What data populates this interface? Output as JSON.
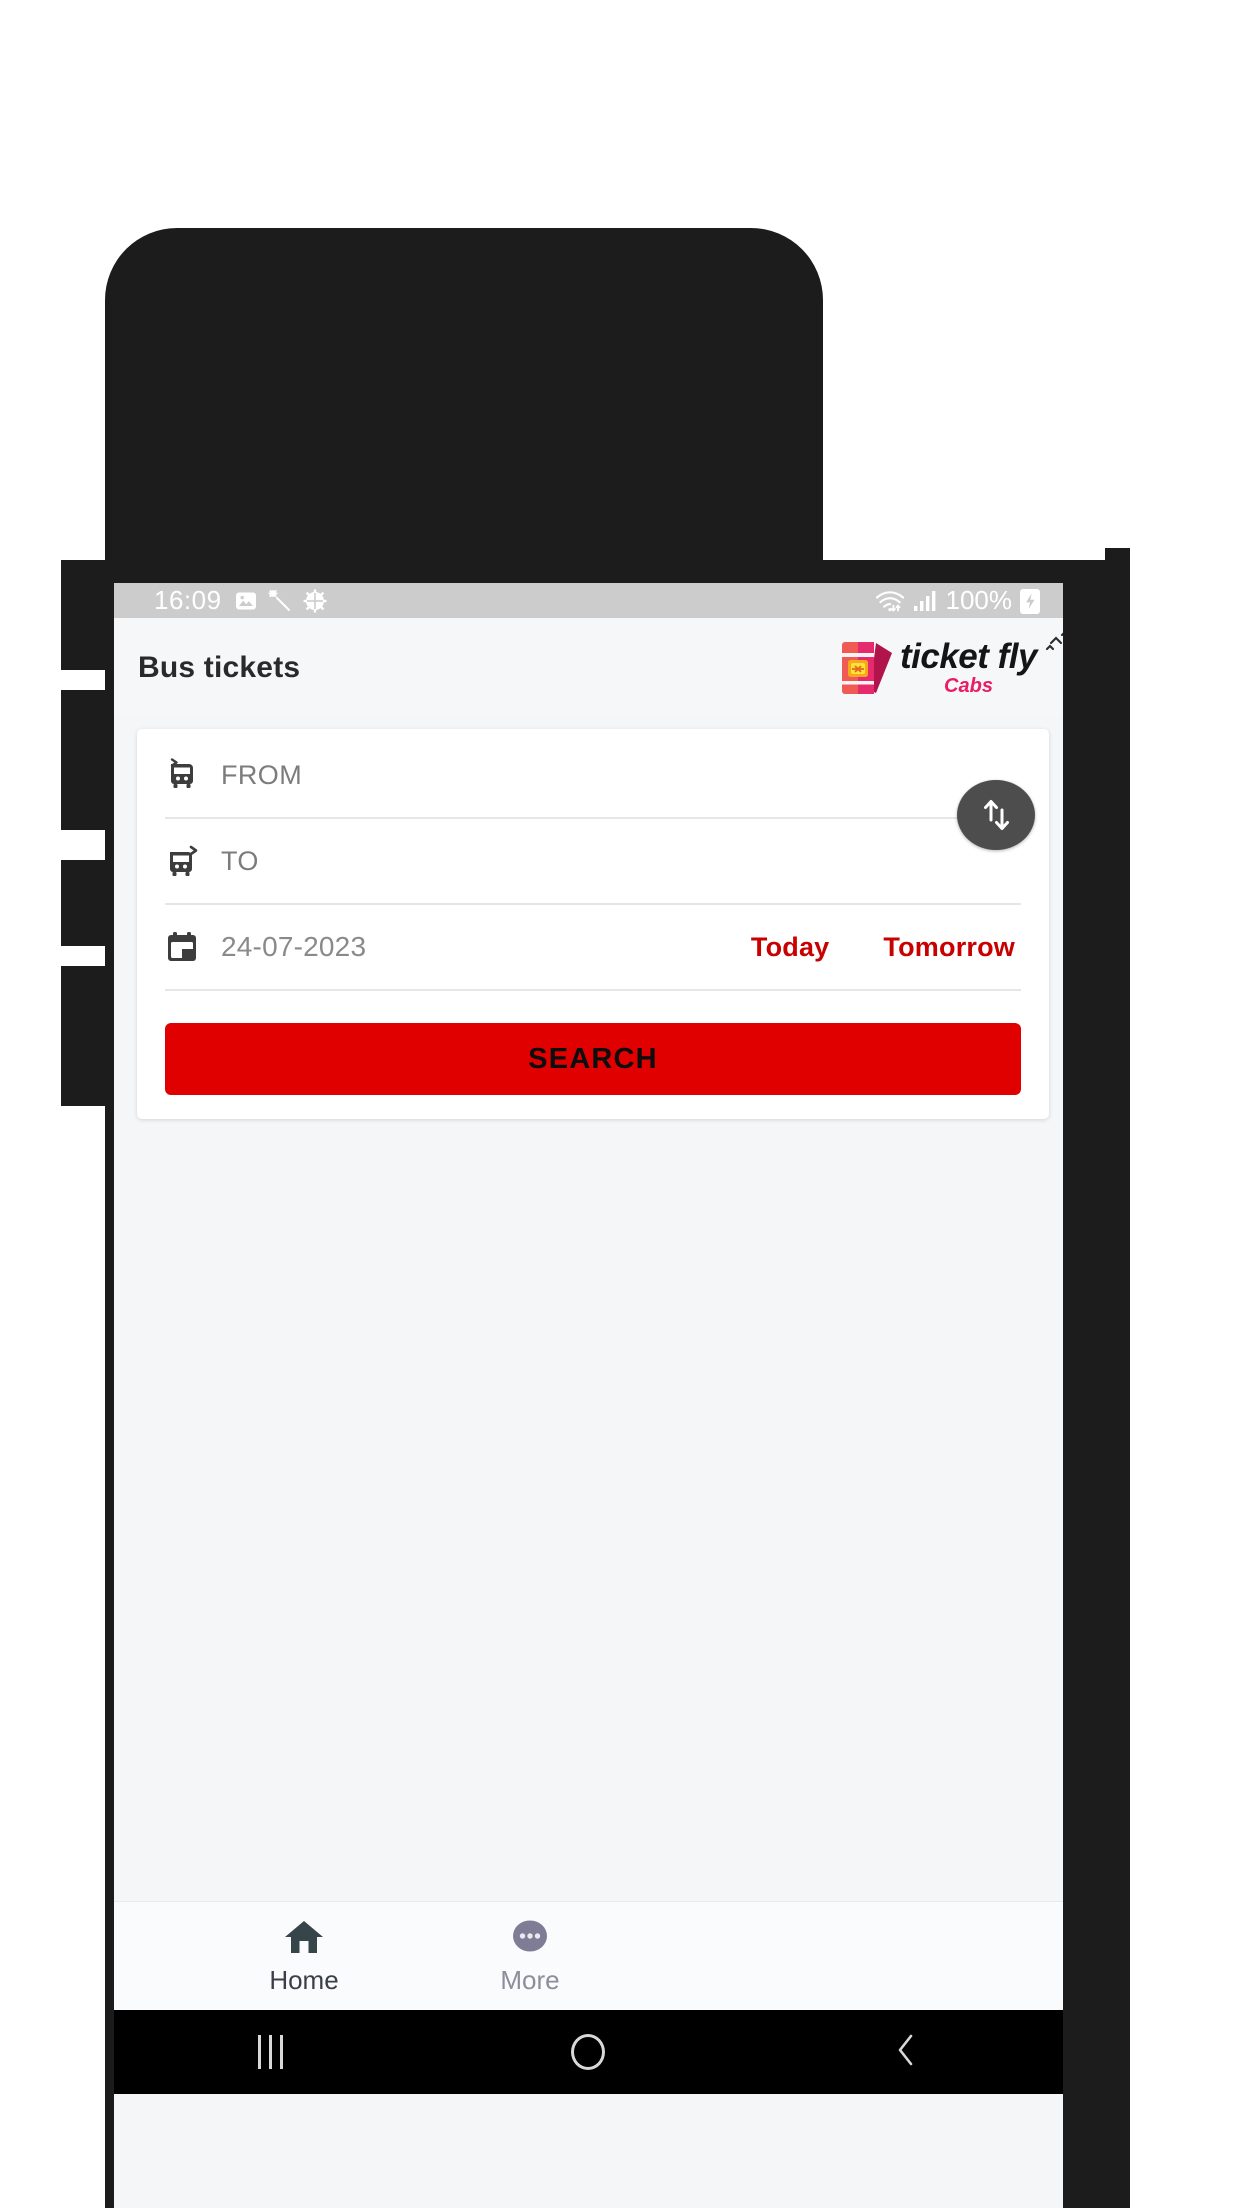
{
  "status_bar": {
    "time": "16:09",
    "left_icons": [
      "image-icon",
      "magic-wand-icon",
      "gear-icon"
    ],
    "right_icons": [
      "wifi-icon",
      "signal-icon",
      "battery-charging-icon"
    ],
    "battery": "100%"
  },
  "app_bar": {
    "title": "Bus tickets",
    "brand_name": "ticket fly",
    "brand_sub": "Cabs"
  },
  "form": {
    "from": {
      "label": "FROM",
      "value": "",
      "icon": "bus-departure-icon"
    },
    "to": {
      "label": "TO",
      "value": "",
      "icon": "bus-arrival-icon"
    },
    "swap": {
      "label": "swap",
      "icon": "swap-vertical-icon"
    },
    "date": {
      "icon": "calendar-icon",
      "value": "24-07-2023",
      "today_label": "Today",
      "tomorrow_label": "Tomorrow"
    },
    "search_label": "SEARCH"
  },
  "bottom_nav": [
    {
      "label": "Home",
      "icon": "home-icon",
      "active": true
    },
    {
      "label": "More",
      "icon": "more-dots-icon",
      "active": false
    }
  ],
  "android_nav": {
    "recents": "recents-icon",
    "home": "home-circle-icon",
    "back": "back-chevron-icon"
  },
  "colors": {
    "accent_red": "#e00000",
    "quick_date_red": "#c80000",
    "brand_pink": "#e81d62",
    "screen_bg": "#f4f6f8",
    "status_bar_bg": "#cccccc"
  }
}
